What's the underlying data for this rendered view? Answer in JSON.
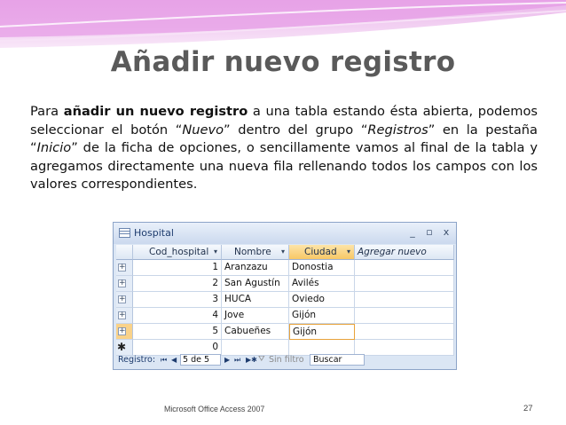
{
  "slide": {
    "title": "Añadir nuevo registro",
    "paragraph": {
      "t1": "Para ",
      "b1": "añadir un nuevo registro",
      "t2": " a una tabla estando ésta abierta, podemos seleccionar el botón “",
      "i1": "Nuevo",
      "t3": "” dentro del grupo “",
      "i2": "Registros",
      "t4": "” en la pestaña “",
      "i3": "Inicio",
      "t5": "” de la ficha de opciones, o sencillamente vamos al final de la tabla y agregamos directamente una nueva fila rellenando todos los campos con los valores correspondientes."
    },
    "footer_left": "Microsoft Office Access 2007",
    "page_number": "27"
  },
  "window": {
    "title": "Hospital",
    "minimize_glyph": "_",
    "maximize_glyph": "▫",
    "close_glyph": "x"
  },
  "table": {
    "columns": [
      {
        "label": "Cod_hospital",
        "arrow": "▾"
      },
      {
        "label": "Nombre",
        "arrow": "▾"
      },
      {
        "label": "Ciudad",
        "arrow": "▾"
      },
      {
        "label": "Agregar nuevo campo"
      }
    ],
    "rows": [
      {
        "id": "1",
        "nombre": "Aranzazu",
        "ciudad": "Donostia"
      },
      {
        "id": "2",
        "nombre": "San Agustín",
        "ciudad": "Avilés"
      },
      {
        "id": "3",
        "nombre": "HUCA",
        "ciudad": "Oviedo"
      },
      {
        "id": "4",
        "nombre": "Jove",
        "ciudad": "Gijón"
      },
      {
        "id": "5",
        "nombre": "Cabueñes",
        "ciudad": "Gijón"
      }
    ],
    "new_row": {
      "id": "0",
      "marker": "✱"
    },
    "expand_glyph": "+"
  },
  "navigator": {
    "label": "Registro:",
    "first": "⏮",
    "prev": "◀",
    "position": "5 de 5",
    "next": "▶",
    "last": "⏭",
    "new": "▶✱",
    "filter_label": "Sin filtro",
    "search_placeholder": "Buscar"
  },
  "colors": {
    "title": "#5a5a5a",
    "header_active": "#f7c766",
    "grid_border": "#c9d6e8",
    "window_bg": "#dbe6f4"
  }
}
